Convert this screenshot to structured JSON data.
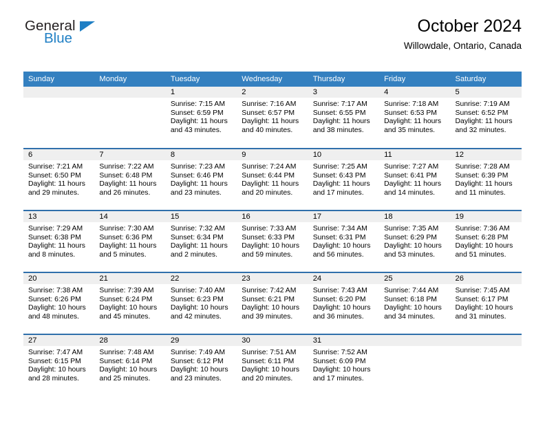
{
  "brand": {
    "name_part1": "General",
    "name_part2": "Blue",
    "triangle_icon": "triangle-icon",
    "accent_color": "#1f7fc4"
  },
  "header": {
    "title": "October 2024",
    "subtitle": "Willowdale, Ontario, Canada"
  },
  "theme": {
    "header_row_bg": "#3480c0",
    "row_divider": "#2f6fab",
    "daynum_band_bg": "#efefef",
    "text": "#000000"
  },
  "weekday_headers": [
    "Sunday",
    "Monday",
    "Tuesday",
    "Wednesday",
    "Thursday",
    "Friday",
    "Saturday"
  ],
  "weeks": [
    [
      {
        "day": "",
        "sunrise": "",
        "sunset": "",
        "daylight_l1": "",
        "daylight_l2": ""
      },
      {
        "day": "",
        "sunrise": "",
        "sunset": "",
        "daylight_l1": "",
        "daylight_l2": ""
      },
      {
        "day": "1",
        "sunrise": "Sunrise: 7:15 AM",
        "sunset": "Sunset: 6:59 PM",
        "daylight_l1": "Daylight: 11 hours",
        "daylight_l2": "and 43 minutes."
      },
      {
        "day": "2",
        "sunrise": "Sunrise: 7:16 AM",
        "sunset": "Sunset: 6:57 PM",
        "daylight_l1": "Daylight: 11 hours",
        "daylight_l2": "and 40 minutes."
      },
      {
        "day": "3",
        "sunrise": "Sunrise: 7:17 AM",
        "sunset": "Sunset: 6:55 PM",
        "daylight_l1": "Daylight: 11 hours",
        "daylight_l2": "and 38 minutes."
      },
      {
        "day": "4",
        "sunrise": "Sunrise: 7:18 AM",
        "sunset": "Sunset: 6:53 PM",
        "daylight_l1": "Daylight: 11 hours",
        "daylight_l2": "and 35 minutes."
      },
      {
        "day": "5",
        "sunrise": "Sunrise: 7:19 AM",
        "sunset": "Sunset: 6:52 PM",
        "daylight_l1": "Daylight: 11 hours",
        "daylight_l2": "and 32 minutes."
      }
    ],
    [
      {
        "day": "6",
        "sunrise": "Sunrise: 7:21 AM",
        "sunset": "Sunset: 6:50 PM",
        "daylight_l1": "Daylight: 11 hours",
        "daylight_l2": "and 29 minutes."
      },
      {
        "day": "7",
        "sunrise": "Sunrise: 7:22 AM",
        "sunset": "Sunset: 6:48 PM",
        "daylight_l1": "Daylight: 11 hours",
        "daylight_l2": "and 26 minutes."
      },
      {
        "day": "8",
        "sunrise": "Sunrise: 7:23 AM",
        "sunset": "Sunset: 6:46 PM",
        "daylight_l1": "Daylight: 11 hours",
        "daylight_l2": "and 23 minutes."
      },
      {
        "day": "9",
        "sunrise": "Sunrise: 7:24 AM",
        "sunset": "Sunset: 6:44 PM",
        "daylight_l1": "Daylight: 11 hours",
        "daylight_l2": "and 20 minutes."
      },
      {
        "day": "10",
        "sunrise": "Sunrise: 7:25 AM",
        "sunset": "Sunset: 6:43 PM",
        "daylight_l1": "Daylight: 11 hours",
        "daylight_l2": "and 17 minutes."
      },
      {
        "day": "11",
        "sunrise": "Sunrise: 7:27 AM",
        "sunset": "Sunset: 6:41 PM",
        "daylight_l1": "Daylight: 11 hours",
        "daylight_l2": "and 14 minutes."
      },
      {
        "day": "12",
        "sunrise": "Sunrise: 7:28 AM",
        "sunset": "Sunset: 6:39 PM",
        "daylight_l1": "Daylight: 11 hours",
        "daylight_l2": "and 11 minutes."
      }
    ],
    [
      {
        "day": "13",
        "sunrise": "Sunrise: 7:29 AM",
        "sunset": "Sunset: 6:38 PM",
        "daylight_l1": "Daylight: 11 hours",
        "daylight_l2": "and 8 minutes."
      },
      {
        "day": "14",
        "sunrise": "Sunrise: 7:30 AM",
        "sunset": "Sunset: 6:36 PM",
        "daylight_l1": "Daylight: 11 hours",
        "daylight_l2": "and 5 minutes."
      },
      {
        "day": "15",
        "sunrise": "Sunrise: 7:32 AM",
        "sunset": "Sunset: 6:34 PM",
        "daylight_l1": "Daylight: 11 hours",
        "daylight_l2": "and 2 minutes."
      },
      {
        "day": "16",
        "sunrise": "Sunrise: 7:33 AM",
        "sunset": "Sunset: 6:33 PM",
        "daylight_l1": "Daylight: 10 hours",
        "daylight_l2": "and 59 minutes."
      },
      {
        "day": "17",
        "sunrise": "Sunrise: 7:34 AM",
        "sunset": "Sunset: 6:31 PM",
        "daylight_l1": "Daylight: 10 hours",
        "daylight_l2": "and 56 minutes."
      },
      {
        "day": "18",
        "sunrise": "Sunrise: 7:35 AM",
        "sunset": "Sunset: 6:29 PM",
        "daylight_l1": "Daylight: 10 hours",
        "daylight_l2": "and 53 minutes."
      },
      {
        "day": "19",
        "sunrise": "Sunrise: 7:36 AM",
        "sunset": "Sunset: 6:28 PM",
        "daylight_l1": "Daylight: 10 hours",
        "daylight_l2": "and 51 minutes."
      }
    ],
    [
      {
        "day": "20",
        "sunrise": "Sunrise: 7:38 AM",
        "sunset": "Sunset: 6:26 PM",
        "daylight_l1": "Daylight: 10 hours",
        "daylight_l2": "and 48 minutes."
      },
      {
        "day": "21",
        "sunrise": "Sunrise: 7:39 AM",
        "sunset": "Sunset: 6:24 PM",
        "daylight_l1": "Daylight: 10 hours",
        "daylight_l2": "and 45 minutes."
      },
      {
        "day": "22",
        "sunrise": "Sunrise: 7:40 AM",
        "sunset": "Sunset: 6:23 PM",
        "daylight_l1": "Daylight: 10 hours",
        "daylight_l2": "and 42 minutes."
      },
      {
        "day": "23",
        "sunrise": "Sunrise: 7:42 AM",
        "sunset": "Sunset: 6:21 PM",
        "daylight_l1": "Daylight: 10 hours",
        "daylight_l2": "and 39 minutes."
      },
      {
        "day": "24",
        "sunrise": "Sunrise: 7:43 AM",
        "sunset": "Sunset: 6:20 PM",
        "daylight_l1": "Daylight: 10 hours",
        "daylight_l2": "and 36 minutes."
      },
      {
        "day": "25",
        "sunrise": "Sunrise: 7:44 AM",
        "sunset": "Sunset: 6:18 PM",
        "daylight_l1": "Daylight: 10 hours",
        "daylight_l2": "and 34 minutes."
      },
      {
        "day": "26",
        "sunrise": "Sunrise: 7:45 AM",
        "sunset": "Sunset: 6:17 PM",
        "daylight_l1": "Daylight: 10 hours",
        "daylight_l2": "and 31 minutes."
      }
    ],
    [
      {
        "day": "27",
        "sunrise": "Sunrise: 7:47 AM",
        "sunset": "Sunset: 6:15 PM",
        "daylight_l1": "Daylight: 10 hours",
        "daylight_l2": "and 28 minutes."
      },
      {
        "day": "28",
        "sunrise": "Sunrise: 7:48 AM",
        "sunset": "Sunset: 6:14 PM",
        "daylight_l1": "Daylight: 10 hours",
        "daylight_l2": "and 25 minutes."
      },
      {
        "day": "29",
        "sunrise": "Sunrise: 7:49 AM",
        "sunset": "Sunset: 6:12 PM",
        "daylight_l1": "Daylight: 10 hours",
        "daylight_l2": "and 23 minutes."
      },
      {
        "day": "30",
        "sunrise": "Sunrise: 7:51 AM",
        "sunset": "Sunset: 6:11 PM",
        "daylight_l1": "Daylight: 10 hours",
        "daylight_l2": "and 20 minutes."
      },
      {
        "day": "31",
        "sunrise": "Sunrise: 7:52 AM",
        "sunset": "Sunset: 6:09 PM",
        "daylight_l1": "Daylight: 10 hours",
        "daylight_l2": "and 17 minutes."
      },
      {
        "day": "",
        "sunrise": "",
        "sunset": "",
        "daylight_l1": "",
        "daylight_l2": ""
      },
      {
        "day": "",
        "sunrise": "",
        "sunset": "",
        "daylight_l1": "",
        "daylight_l2": ""
      }
    ]
  ]
}
